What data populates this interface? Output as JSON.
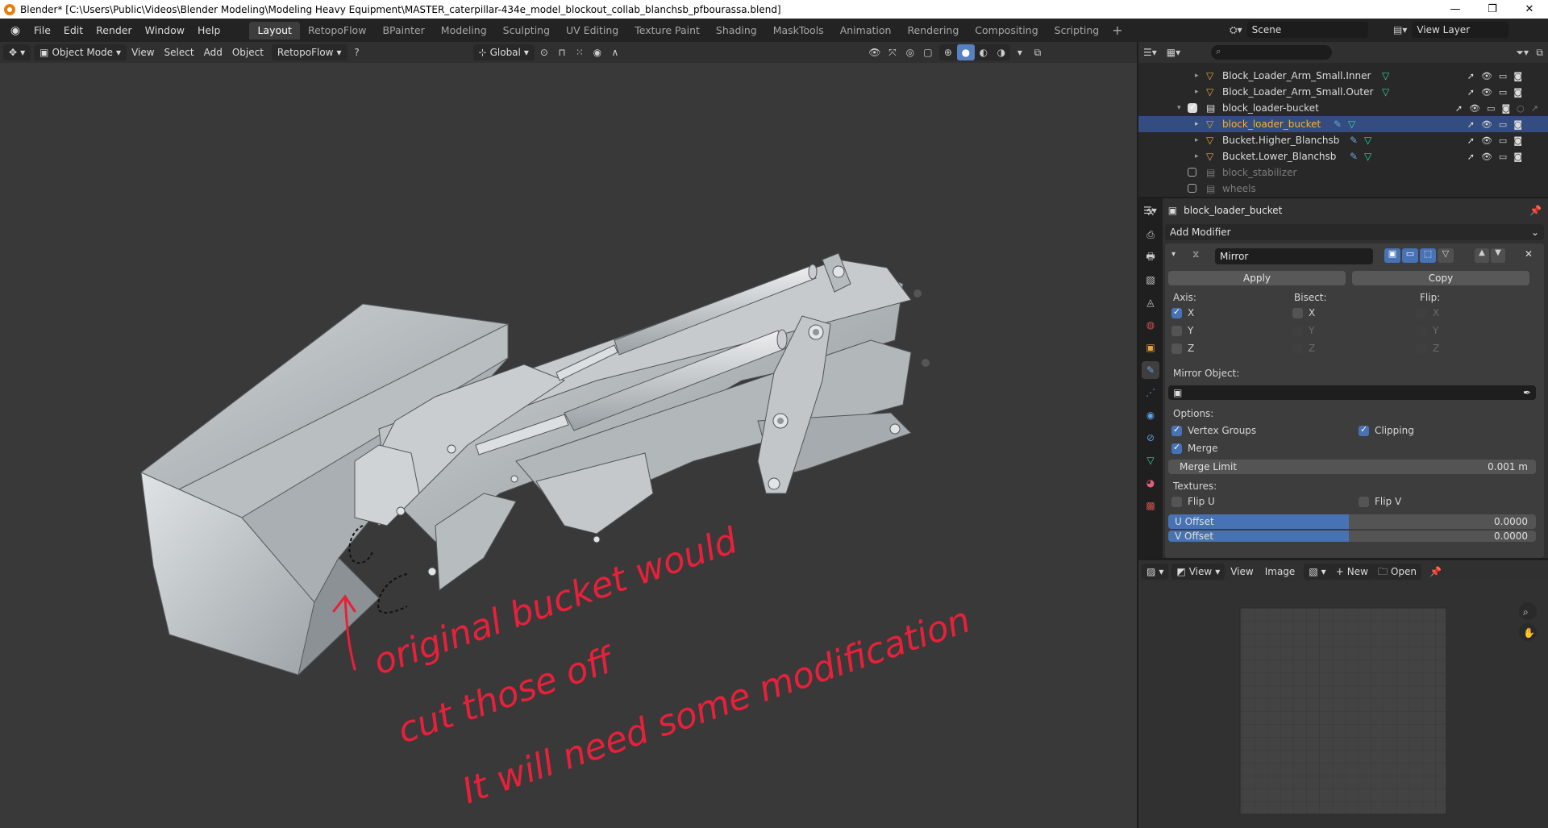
{
  "titlebar": {
    "title": "Blender* [C:\\Users\\Public\\Videos\\Blender Modeling\\Modeling Heavy Equipment\\MASTER_caterpillar-434e_model_blockout_collab_blanchsb_pfbourassa.blend]"
  },
  "menu": {
    "items": [
      "File",
      "Edit",
      "Render",
      "Window",
      "Help"
    ],
    "workspaces": [
      "Layout",
      "RetopoFlow",
      "BPainter",
      "Modeling",
      "Sculpting",
      "UV Editing",
      "Texture Paint",
      "Shading",
      "MaskTools",
      "Animation",
      "Rendering",
      "Compositing",
      "Scripting"
    ],
    "active_workspace": "Layout",
    "scene": "Scene",
    "view_layer": "View Layer"
  },
  "viewport": {
    "mode": "Object Mode",
    "menus": [
      "View",
      "Select",
      "Add",
      "Object"
    ],
    "addon_menu": "RetopoFlow",
    "transform_orientation": "Global",
    "annotation": {
      "line1": "original bucket would",
      "line2": "cut those off",
      "line3": "It will need some modification"
    },
    "annotation_color": "#e8203a"
  },
  "outliner": {
    "rows": [
      {
        "name": "Block_Loader_Arm_Small.Inner",
        "type": "mesh",
        "state": "normal"
      },
      {
        "name": "Block_Loader_Arm_Small.Outer",
        "type": "mesh",
        "state": "normal"
      },
      {
        "name": "block_loader-bucket",
        "type": "collection",
        "state": "normal"
      },
      {
        "name": "block_loader_bucket",
        "type": "mesh",
        "state": "selected"
      },
      {
        "name": "Bucket.Higher_Blanchsb",
        "type": "mesh",
        "state": "normal"
      },
      {
        "name": "Bucket.Lower_Blanchsb",
        "type": "mesh",
        "state": "normal"
      },
      {
        "name": "block_stabilizer",
        "type": "collection",
        "state": "disabled"
      },
      {
        "name": "wheels",
        "type": "collection",
        "state": "disabled"
      }
    ]
  },
  "properties": {
    "object_name": "block_loader_bucket",
    "add_modifier_label": "Add Modifier",
    "modifier": {
      "name": "Mirror",
      "apply_label": "Apply",
      "copy_label": "Copy",
      "axis_label": "Axis:",
      "bisect_label": "Bisect:",
      "flip_label": "Flip:",
      "axes": [
        "X",
        "Y",
        "Z"
      ],
      "axis_checked": [
        true,
        false,
        false
      ],
      "mirror_object_label": "Mirror Object:",
      "options_label": "Options:",
      "vertex_groups_label": "Vertex Groups",
      "vertex_groups_checked": true,
      "clipping_label": "Clipping",
      "clipping_checked": true,
      "merge_label": "Merge",
      "merge_checked": true,
      "merge_limit_label": "Merge Limit",
      "merge_limit_value": "0.001 m",
      "textures_label": "Textures:",
      "flip_u_label": "Flip U",
      "flip_v_label": "Flip V",
      "u_offset_label": "U Offset",
      "u_offset_value": "0.0000",
      "v_offset_label": "V Offset",
      "v_offset_value": "0.0000"
    }
  },
  "image_editor": {
    "menus": [
      "View",
      "View",
      "Image"
    ],
    "new_label": "New",
    "open_label": "Open"
  },
  "colors": {
    "accent": "#4772b3",
    "selection_highlight": "#334d80",
    "selected_text": "#ffaf29",
    "mesh_icon": "#e0a940",
    "modifier_icon": "#70a0e0",
    "vertex_group_icon": "#3fd0a6"
  }
}
